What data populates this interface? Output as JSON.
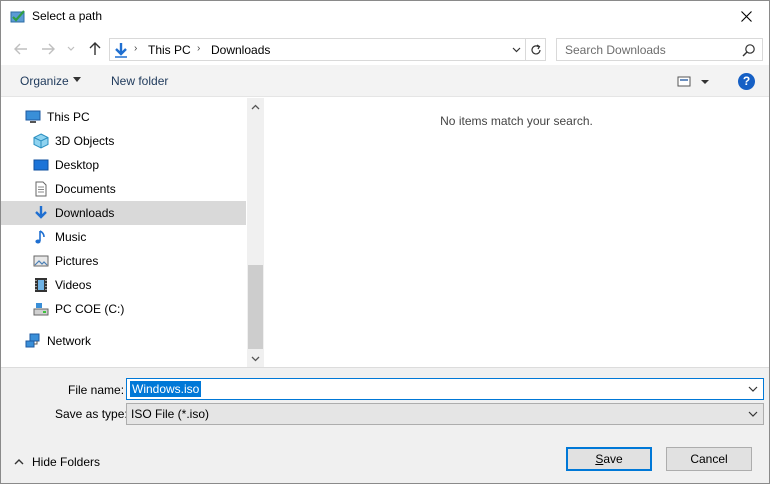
{
  "window": {
    "title": "Select a path"
  },
  "address": {
    "crumbs": [
      "This PC",
      "Downloads"
    ]
  },
  "search": {
    "placeholder": "Search Downloads"
  },
  "commandbar": {
    "organize_label": "Organize",
    "new_folder_label": "New folder",
    "help_label": "?"
  },
  "sidebar": {
    "items": [
      {
        "label": "This PC",
        "icon": "computer-icon"
      },
      {
        "label": "3D Objects",
        "icon": "cube-icon"
      },
      {
        "label": "Desktop",
        "icon": "desktop-icon"
      },
      {
        "label": "Documents",
        "icon": "document-icon"
      },
      {
        "label": "Downloads",
        "icon": "download-icon",
        "selected": true
      },
      {
        "label": "Music",
        "icon": "music-note-icon"
      },
      {
        "label": "Pictures",
        "icon": "picture-icon"
      },
      {
        "label": "Videos",
        "icon": "film-icon"
      },
      {
        "label": "PC COE (C:)",
        "icon": "drive-icon"
      },
      {
        "label": "Network",
        "icon": "network-icon"
      }
    ]
  },
  "content": {
    "empty_message": "No items match your search."
  },
  "form": {
    "filename_label": "File name:",
    "filename_value": "Windows.iso",
    "savetype_label": "Save as type:",
    "savetype_value": "ISO File (*.iso)"
  },
  "footer": {
    "hide_folders_label": "Hide Folders",
    "save_label": "Save",
    "cancel_label": "Cancel"
  },
  "colors": {
    "accent": "#0078d7",
    "help": "#1660c5",
    "selection": "#d9d9d9"
  }
}
